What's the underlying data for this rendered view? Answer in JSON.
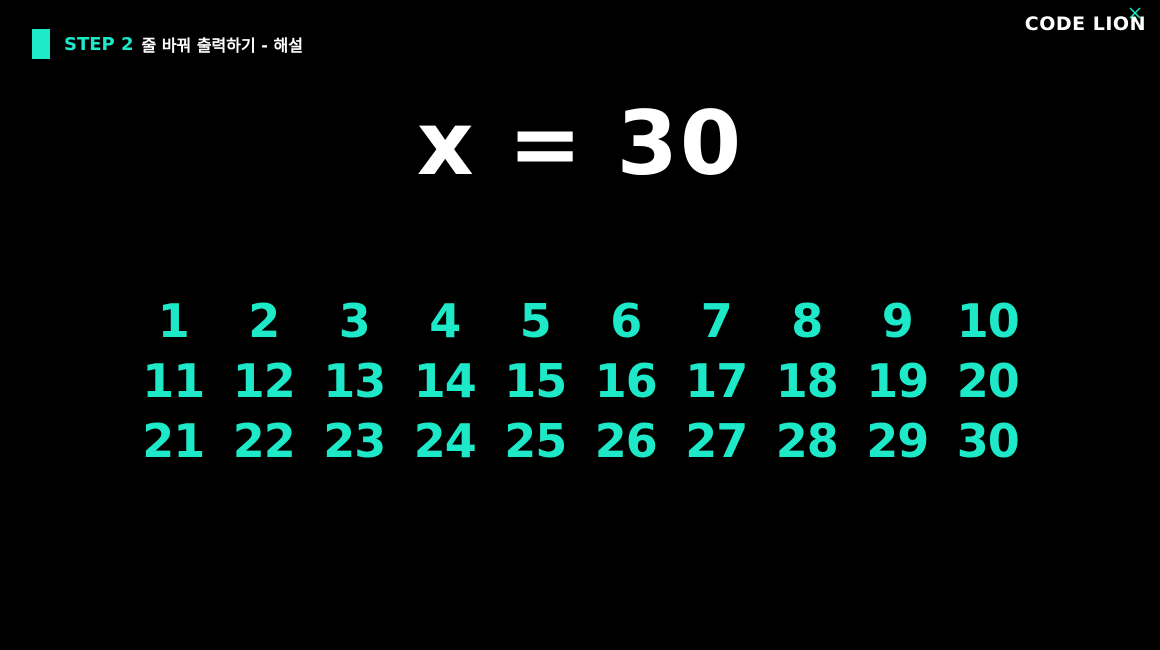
{
  "header": {
    "step_label": "STEP 2",
    "title": "줄 바꿔 출력하기 - 해설",
    "accent_color": "#1de9c8"
  },
  "logo": {
    "text": "CODE LION"
  },
  "slide": {
    "equation": "x = 30",
    "numbers": [
      "1",
      "2",
      "3",
      "4",
      "5",
      "6",
      "7",
      "8",
      "9",
      "10",
      "11",
      "12",
      "13",
      "14",
      "15",
      "16",
      "17",
      "18",
      "19",
      "20",
      "21",
      "22",
      "23",
      "24",
      "25",
      "26",
      "27",
      "28",
      "29",
      "30"
    ]
  }
}
